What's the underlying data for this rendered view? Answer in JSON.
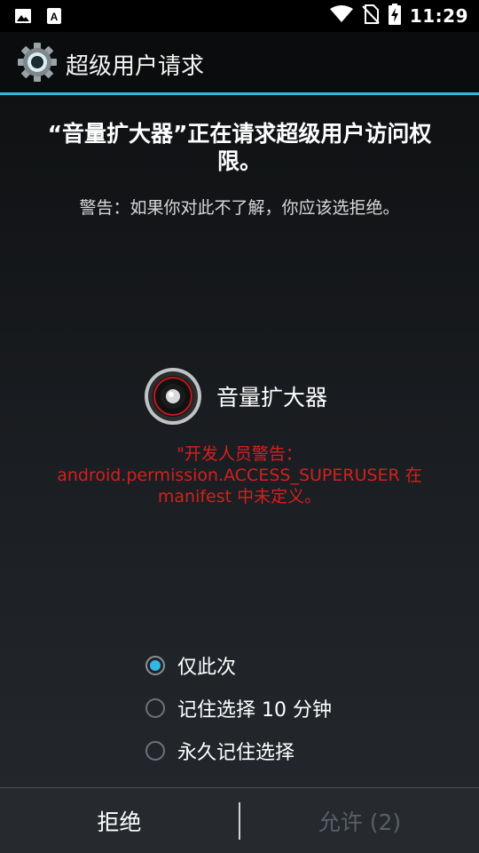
{
  "status_bar": {
    "time": "11:29",
    "icons": [
      "image-icon",
      "text-a-icon",
      "wifi-icon",
      "no-sim-icon",
      "battery-charging-icon"
    ]
  },
  "title_bar": {
    "title": "超级用户请求"
  },
  "request": {
    "title": "“音量扩大器”正在请求超级用户访问权限。",
    "warning": "警告：如果你对此不了解，你应该选拒绝。"
  },
  "app": {
    "name": "音量扩大器",
    "icon": "speaker-icon"
  },
  "developer_warning": "\"开发人员警告：android.permission.ACCESS_SUPERUSER 在 manifest 中未定义。",
  "options": [
    {
      "label": "仅此次",
      "checked": true
    },
    {
      "label": "记住选择 10 分钟",
      "checked": false
    },
    {
      "label": "永久记住选择",
      "checked": false
    }
  ],
  "buttons": {
    "deny": "拒绝",
    "allow": "允许 (2)"
  },
  "colors": {
    "accent": "#33b5e5",
    "warning_red": "#d4201e"
  }
}
